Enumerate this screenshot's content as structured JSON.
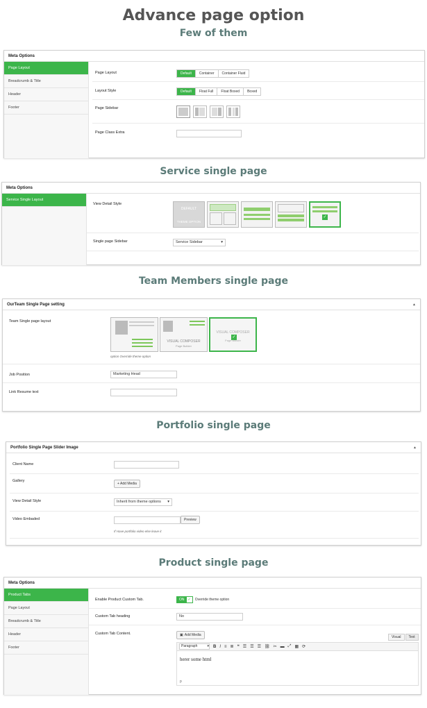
{
  "title": "Advance page option",
  "s1": {
    "heading": "Few of them",
    "panel_title": "Meta Options",
    "tabs": [
      "Page Layout",
      "Breadcrumb & Title",
      "Header",
      "Footer"
    ],
    "page_layout": {
      "label": "Page Layout",
      "options": [
        "Default",
        "Container",
        "Container Fluid"
      ],
      "selected": "Default"
    },
    "layout_style": {
      "label": "Layout Style",
      "options": [
        "Default",
        "Float Full",
        "Float Boxed",
        "Boxed"
      ],
      "selected": "Default"
    },
    "page_sidebar": {
      "label": "Page Sidebar"
    },
    "page_class": {
      "label": "Page Class Extra",
      "value": ""
    }
  },
  "s2": {
    "heading": "Service single page",
    "panel_title": "Meta Options",
    "tabs": [
      "Service Single Layout"
    ],
    "view_detail": {
      "label": "View Detail Style",
      "thumb_text_1": "DEFAULT",
      "thumb_text_2": "THEME OPTION"
    },
    "sidebar": {
      "label": "Single page Sidebar",
      "value": "Service Sidebar"
    }
  },
  "s3": {
    "heading": "Team Members single page",
    "panel_title": "OurTeam Single Page setting",
    "layout": {
      "label": "Team Single page layout",
      "vc1": "VISUAL COMPOSER",
      "vc1_sub": "Page Builder",
      "vc2": "VISUAL COMPOSER",
      "vc2_sub": "Page Builder",
      "note": "option Override theme option"
    },
    "job": {
      "label": "Job Position",
      "value": "Marketing Head"
    },
    "resume": {
      "label": "Link Resume text",
      "value": ""
    }
  },
  "s4": {
    "heading": "Portfolio single page",
    "panel_title": "Portfolio Single Page Slider Image",
    "client": {
      "label": "Client Name",
      "value": ""
    },
    "gallery": {
      "label": "Gallery",
      "button": "+ Add Media"
    },
    "view_detail": {
      "label": "View Detail Style",
      "value": "Inherit from theme options"
    },
    "video": {
      "label": "Video Embaded",
      "button": "Preview",
      "note": "If Have portfolio video else leave it"
    }
  },
  "s5": {
    "heading": "Product single page",
    "panel_title": "Meta Options",
    "tabs": [
      "Product Tabs",
      "Page Layout",
      "Breadcrumb & Title",
      "Header",
      "Footer"
    ],
    "enable": {
      "label": "Enable Product Custom Tab.",
      "toggle": "ON",
      "text": "Override theme option"
    },
    "heading_field": {
      "label": "Custom Tab heading",
      "value": "No"
    },
    "content": {
      "label": "Custom Tab Content.",
      "add_media": "Add Media",
      "visual": "Visual",
      "text": "Text",
      "format": "Paragraph",
      "body": "herer some html",
      "path": "p"
    }
  },
  "colors": {
    "accent": "#3cb54a",
    "heading": "#5b7b78"
  },
  "icons": [
    "chevron-up-icon",
    "check-icon",
    "bold-icon",
    "italic-icon",
    "list-icon",
    "quote-icon",
    "align-icon",
    "link-icon",
    "fullscreen-icon"
  ]
}
